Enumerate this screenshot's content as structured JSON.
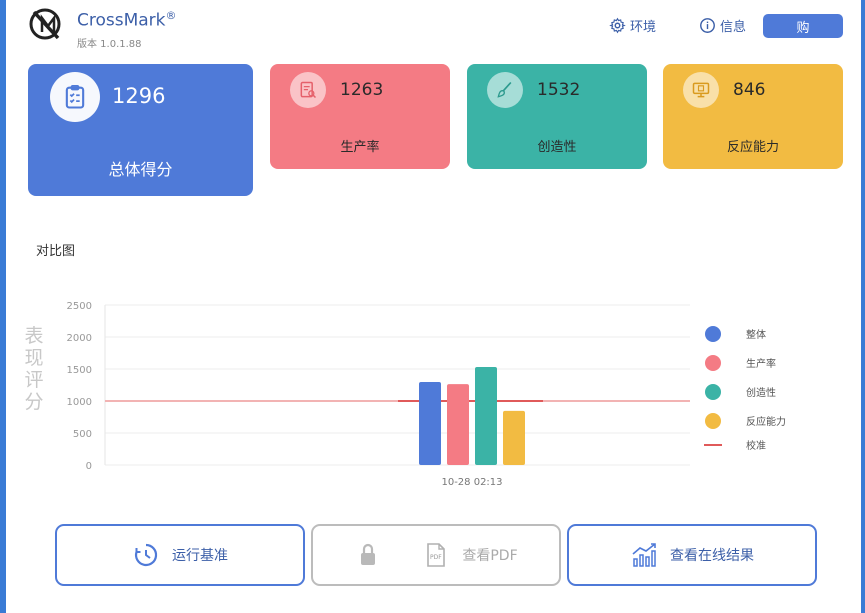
{
  "header": {
    "app_name": "CrossMark",
    "reg_mark": "®",
    "version": "版本 1.0.1.88",
    "env_label": "环境",
    "info_label": "信息",
    "buy_label": "购"
  },
  "cards": {
    "total": {
      "score": "1296",
      "label": "总体得分"
    },
    "productivity": {
      "score": "1263",
      "label": "生产率"
    },
    "creativity": {
      "score": "1532",
      "label": "创造性"
    },
    "responsiveness": {
      "score": "846",
      "label": "反应能力"
    }
  },
  "colors": {
    "blue": "#4f7ad8",
    "pink": "#f47b84",
    "teal": "#3bb3a6",
    "yellow": "#f2bb42",
    "calibration": "#e05a5a"
  },
  "comparison": {
    "title": "对比图"
  },
  "chart_data": {
    "type": "bar",
    "categories": [
      "10-28 02:13"
    ],
    "series": [
      {
        "name": "整体",
        "values": [
          1296
        ],
        "color": "#4f7ad8"
      },
      {
        "name": "生产率",
        "values": [
          1263
        ],
        "color": "#f47b84"
      },
      {
        "name": "创造性",
        "values": [
          1532
        ],
        "color": "#3bb3a6"
      },
      {
        "name": "反应能力",
        "values": [
          846
        ],
        "color": "#f2bb42"
      }
    ],
    "reference_line": {
      "name": "校准",
      "value": 1000,
      "color": "#e05a5a"
    },
    "ylabel": "表现评分",
    "yticks": [
      2500,
      2000,
      1500,
      1000,
      500,
      0
    ],
    "ylim": [
      0,
      2500
    ],
    "legend_position": "right",
    "grid": true
  },
  "buttons": {
    "run": "运行基准",
    "pdf": "查看PDF",
    "online": "查看在线结果"
  }
}
